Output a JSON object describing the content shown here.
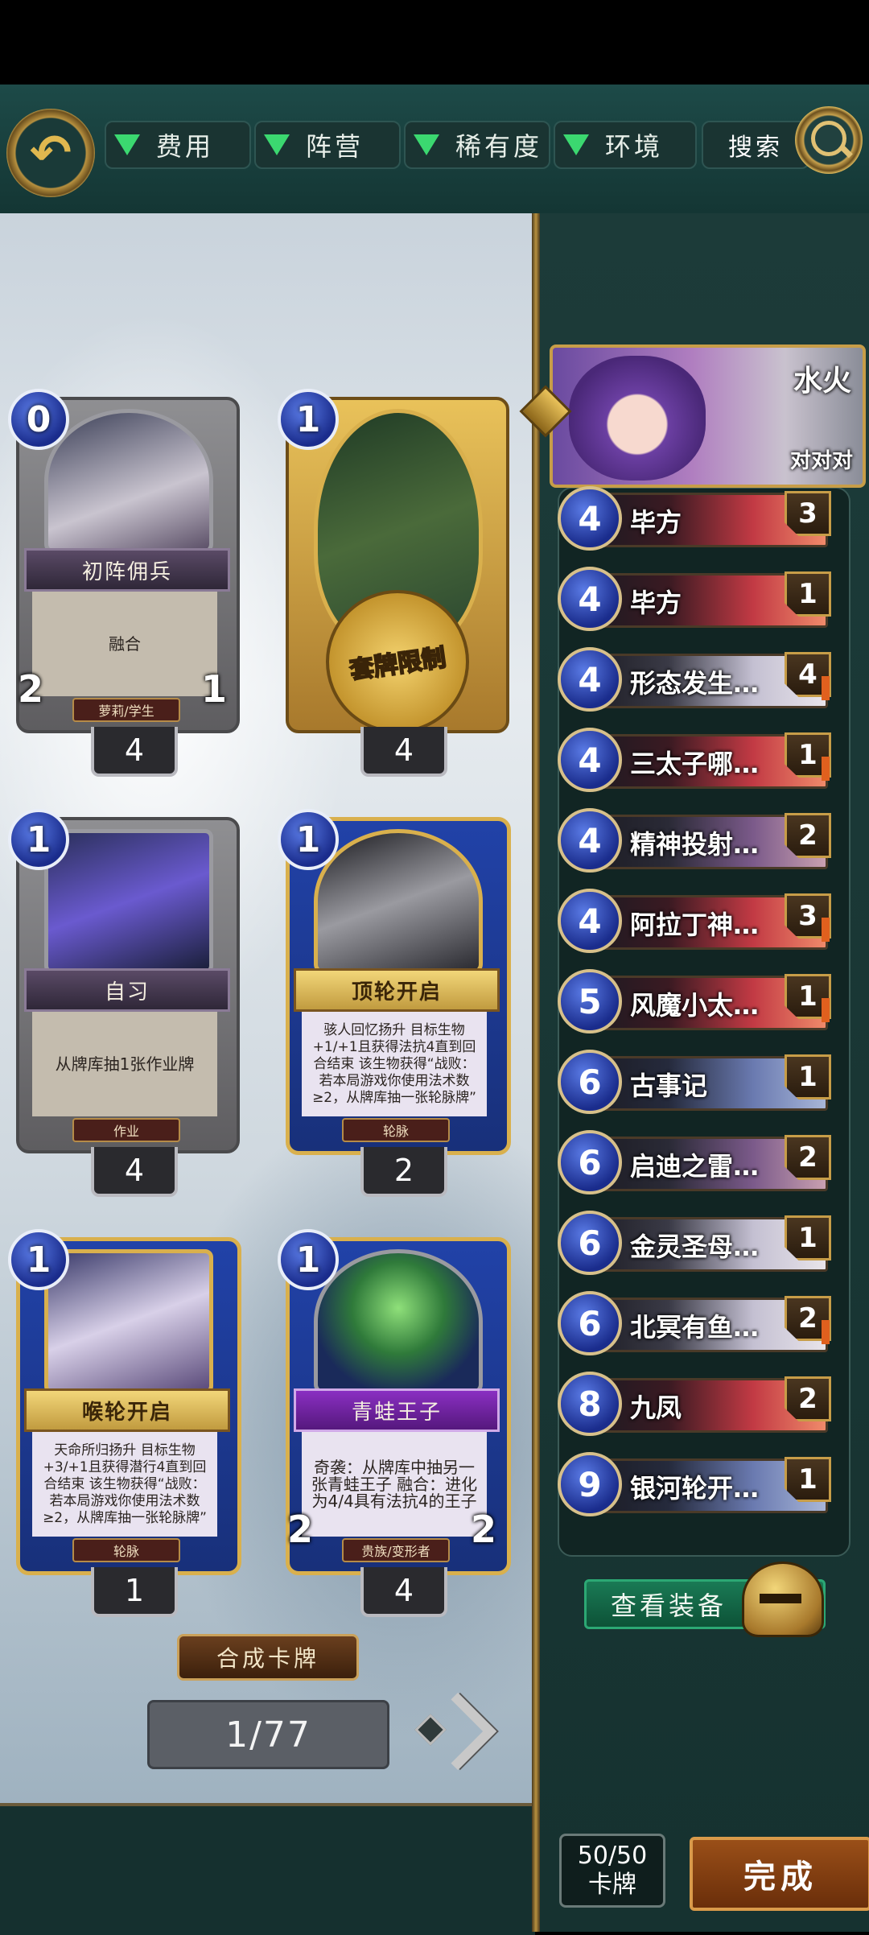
{
  "filters": [
    {
      "label": "费用"
    },
    {
      "label": "阵营"
    },
    {
      "label": "稀有度"
    },
    {
      "label": "环境"
    }
  ],
  "search_label": "搜索",
  "cards": [
    {
      "cost": "0",
      "name": "初阵佣兵",
      "text": "融合",
      "tribe": "萝莉/学生",
      "attack": "2",
      "health": "1",
      "count": "4",
      "style": "silver"
    },
    {
      "cost": "1",
      "name": "",
      "text": "",
      "tribe": "",
      "attack": "",
      "health": "",
      "count": "4",
      "style": "gold",
      "seal": "套牌限制"
    },
    {
      "cost": "1",
      "name": "自习",
      "text": "从牌库抽1张作业牌",
      "tribe": "作业",
      "attack": "",
      "health": "",
      "count": "4",
      "style": "silver"
    },
    {
      "cost": "1",
      "name": "顶轮开启",
      "text": "骇人回忆扬升 目标生物+1/+1且获得法抗4直到回合结束 该生物获得“战败：若本局游戏你使用法术数≥2，从牌库抽一张轮脉牌”",
      "tribe": "轮脉",
      "attack": "",
      "health": "",
      "count": "2",
      "style": "blue"
    },
    {
      "cost": "1",
      "name": "喉轮开启",
      "text": "天命所归扬升 目标生物+3/+1且获得潜行4直到回合结束 该生物获得“战败：若本局游戏你使用法术数≥2，从牌库抽一张轮脉牌”",
      "tribe": "轮脉",
      "attack": "",
      "health": "",
      "count": "1",
      "style": "blue"
    },
    {
      "cost": "1",
      "name": "青蛙王子",
      "text": "奇袭：从牌库中抽另一张青蛙王子 融合：进化为4/4具有法抗4的王子",
      "tribe": "贵族/变形者",
      "attack": "2",
      "health": "2",
      "count": "4",
      "style": "purple"
    }
  ],
  "craft_label": "合成卡牌",
  "pagination": "1/77",
  "hero": {
    "name": "水火",
    "subtitle": "对对对"
  },
  "deck_list": [
    {
      "cost": "4",
      "name": "毕方",
      "count": "3",
      "color": "red"
    },
    {
      "cost": "4",
      "name": "毕方",
      "count": "1",
      "color": "red"
    },
    {
      "cost": "4",
      "name": "形态发生…",
      "count": "4",
      "color": "pale",
      "rare": true
    },
    {
      "cost": "4",
      "name": "三太子哪…",
      "count": "1",
      "color": "red",
      "rare": true
    },
    {
      "cost": "4",
      "name": "精神投射…",
      "count": "2",
      "color": "default"
    },
    {
      "cost": "4",
      "name": "阿拉丁神…",
      "count": "3",
      "color": "red",
      "rare": true
    },
    {
      "cost": "5",
      "name": "风魔小太…",
      "count": "1",
      "color": "red",
      "rare": true
    },
    {
      "cost": "6",
      "name": "古事记",
      "count": "1",
      "color": "blue"
    },
    {
      "cost": "6",
      "name": "启迪之雷…",
      "count": "2",
      "color": "default"
    },
    {
      "cost": "6",
      "name": "金灵圣母…",
      "count": "1",
      "color": "pale"
    },
    {
      "cost": "6",
      "name": "北冥有鱼…",
      "count": "2",
      "color": "pale",
      "rare": true
    },
    {
      "cost": "8",
      "name": "九凤",
      "count": "2",
      "color": "red"
    },
    {
      "cost": "9",
      "name": "银河轮开…",
      "count": "1",
      "color": "blue"
    }
  ],
  "equip_label": "查看装备",
  "deck_total": {
    "value": "50/50",
    "label": "卡牌"
  },
  "done_label": "完成"
}
